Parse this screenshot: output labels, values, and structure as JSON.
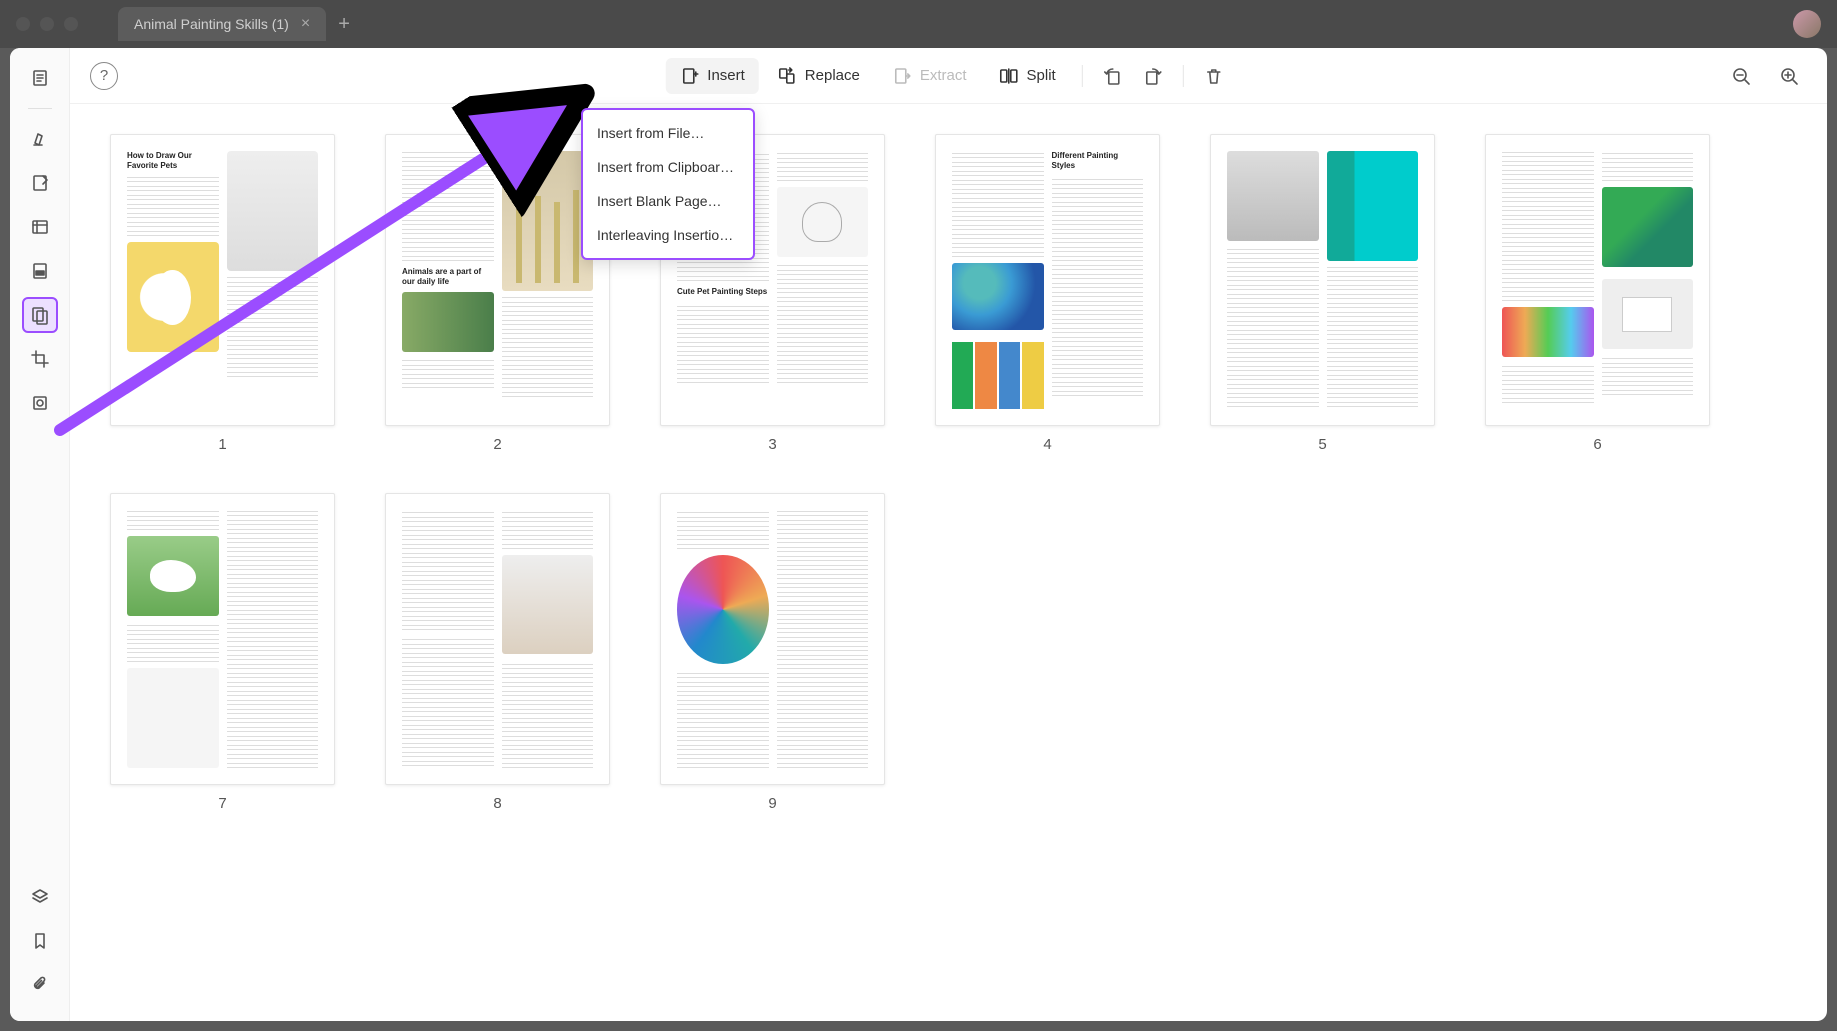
{
  "tab": {
    "title": "Animal Painting Skills (1)"
  },
  "toolbar": {
    "insert": "Insert",
    "replace": "Replace",
    "extract": "Extract",
    "split": "Split"
  },
  "dropdown": {
    "items": [
      "Insert from File…",
      "Insert from Clipboard…",
      "Insert Blank Page…",
      "Interleaving Insertion…"
    ]
  },
  "pages": [
    {
      "num": "1",
      "heading": "How to Draw Our Favorite Pets"
    },
    {
      "num": "2",
      "heading": "Animals are a part of our daily life"
    },
    {
      "num": "3",
      "heading": "Cute Pet Painting Steps"
    },
    {
      "num": "4",
      "heading": "Different Painting Styles"
    },
    {
      "num": "5",
      "heading": ""
    },
    {
      "num": "6",
      "heading": ""
    },
    {
      "num": "7",
      "heading": ""
    },
    {
      "num": "8",
      "heading": ""
    },
    {
      "num": "9",
      "heading": ""
    }
  ],
  "annotation": {
    "color": "#9b4dff"
  }
}
